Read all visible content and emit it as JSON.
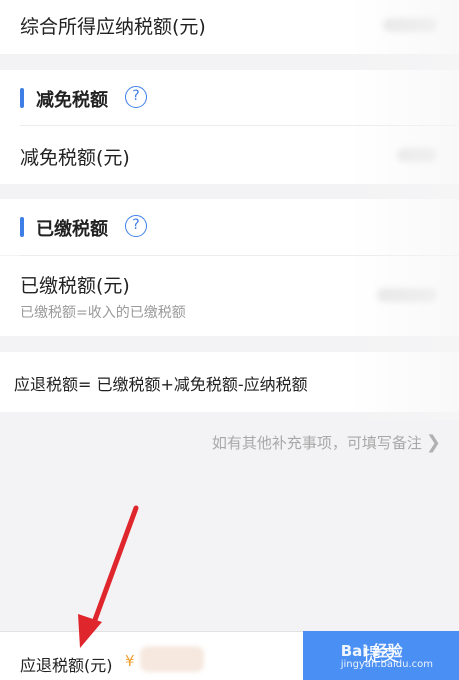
{
  "rows": {
    "comprehensive_tax_label": "综合所得应纳税额(元)",
    "reduced_tax_label": "减免税额(元)",
    "paid_tax_label": "已缴税额(元)",
    "paid_tax_hint": "已缴税额=收入的已缴税额"
  },
  "sections": {
    "reduced": {
      "title": "减免税额",
      "help": "?"
    },
    "paid": {
      "title": "已缴税额",
      "help": "?"
    }
  },
  "formula": "应退税额= 已缴税额+减免税额-应纳税额",
  "remark_link": "如有其他补充事项，可填写备注",
  "bottom": {
    "label": "应退税额(元)",
    "currency": "¥",
    "submit_label": "提交"
  },
  "watermark": {
    "brand": "Bai 经验",
    "site": "jingyan.baidu.com"
  },
  "colors": {
    "accent": "#3d7fe6",
    "button": "#4a8ff4",
    "arrow": "#e0262d",
    "currency": "#f0a030"
  }
}
